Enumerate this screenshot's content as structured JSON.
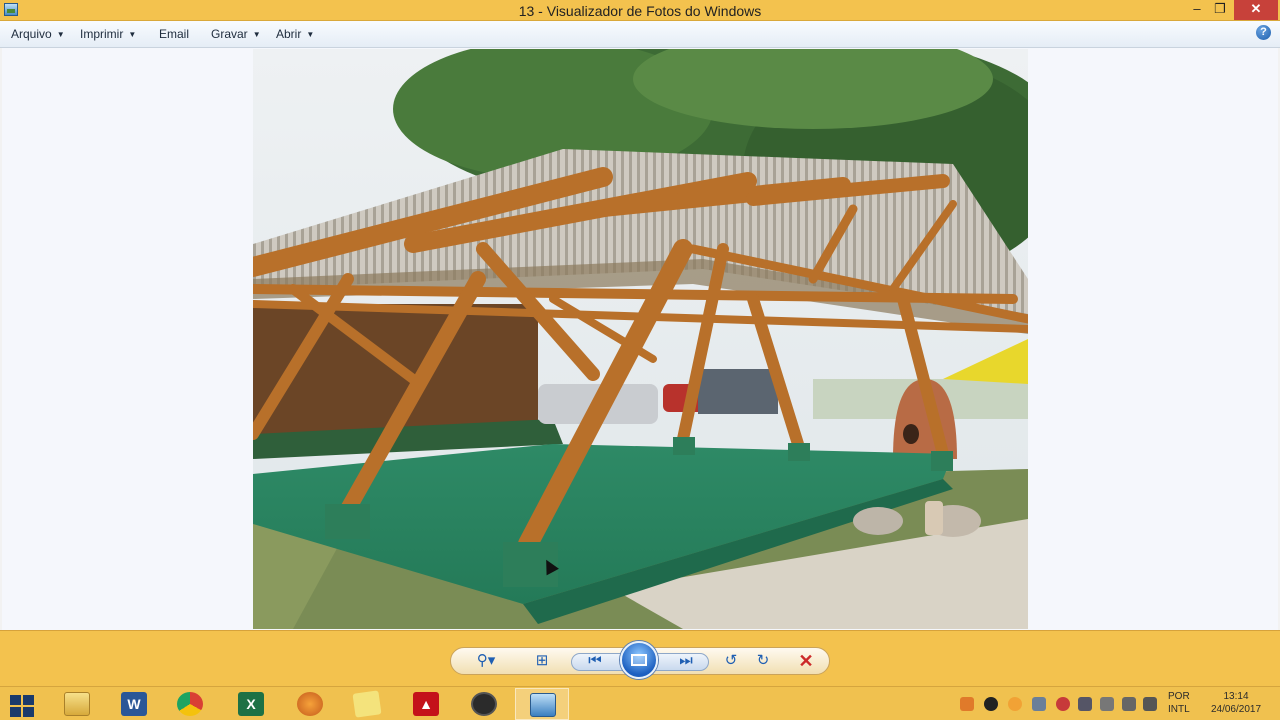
{
  "window": {
    "title": "13 - Visualizador de Fotos do Windows",
    "controls": {
      "minimize": "–",
      "maximize": "❐",
      "close": "✕"
    }
  },
  "menu": {
    "items": [
      {
        "label": "Arquivo",
        "has_dropdown": true
      },
      {
        "label": "Imprimir",
        "has_dropdown": true
      },
      {
        "label": "Email",
        "has_dropdown": false
      },
      {
        "label": "Gravar",
        "has_dropdown": true
      },
      {
        "label": "Abrir",
        "has_dropdown": true
      }
    ],
    "help": "?"
  },
  "photo": {
    "subject": "bamboo-pavilion-photo"
  },
  "controls": {
    "icons": [
      "zoom-icon",
      "fit-window-icon",
      "previous-icon",
      "slideshow-icon",
      "next-icon",
      "rotate-left-icon",
      "rotate-right-icon",
      "delete-icon"
    ]
  },
  "taskbar": {
    "apps": [
      "file-explorer",
      "word",
      "chrome",
      "excel",
      "media-player",
      "sticky-notes",
      "acrobat",
      "obs",
      "photo-viewer"
    ],
    "active_app": "photo-viewer",
    "language": {
      "line1": "POR",
      "line2": "INTL"
    },
    "clock": {
      "time": "13:14",
      "date": "24/06/2017"
    }
  },
  "colors": {
    "accent": "#f3c24e",
    "close_button": "#c7413a",
    "floor_green": "#2f8a64",
    "bamboo": "#b8702a"
  }
}
